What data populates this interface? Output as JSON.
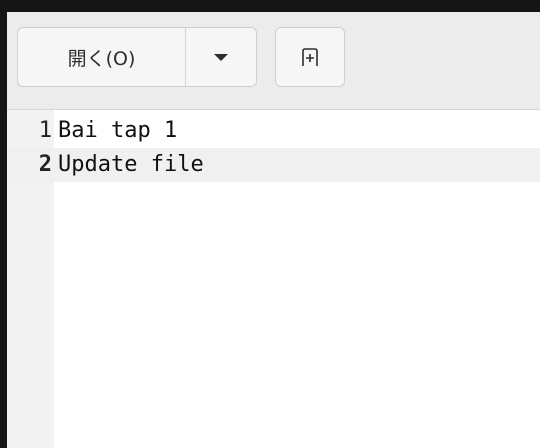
{
  "toolbar": {
    "open_label": "開く(O)",
    "open_menu_icon": "chevron-down-icon",
    "new_tab_icon": "new-tab-icon"
  },
  "editor": {
    "lines": [
      {
        "number": "1",
        "text": "Bai tap 1"
      },
      {
        "number": "2",
        "text": "Update file"
      }
    ],
    "current_line": 2
  },
  "colors": {
    "window_border": "#151515",
    "header_background": "#ececec",
    "current_line_background": "#f0f0f0"
  }
}
